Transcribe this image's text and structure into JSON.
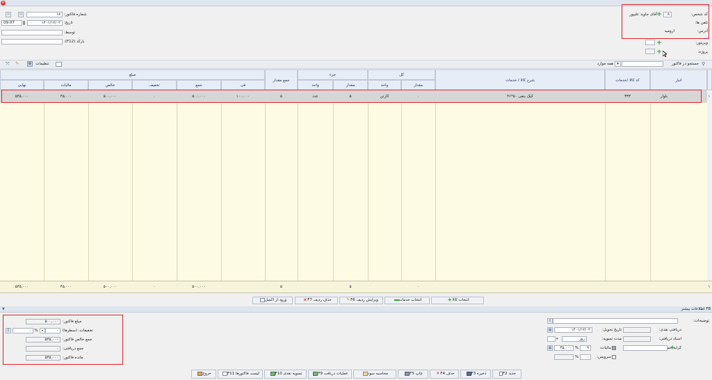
{
  "colors": {
    "accent": "#e0202a",
    "plus": "#2e9a3a",
    "grid_bg": "#fdfbe4",
    "row_selected": "#d6d6d6"
  },
  "header_right": {
    "person_code_label": "کد شخص:",
    "person_code_value": "۸",
    "person_name": "آقای جاوید علیپور",
    "phone_label": "تلفن ها:",
    "address_label": "آدرس:",
    "address_value": "ارومیه",
    "visitor_label": "ویزیتور:",
    "project_label": "پروژه:"
  },
  "header_left": {
    "invoice_no_label": "شماره فاکتور:",
    "invoice_no_value": "۱۸",
    "date_label": "تاریخ:",
    "date_value": "۱۴۰۱/۱۲/۰۲",
    "time_value": "09:07",
    "by_label": "توسط:",
    "barcode_label": "بارکد (F12):"
  },
  "search": {
    "label": "جستجو در فاکتور",
    "scope": "همه موارد",
    "settings_label": "تنظیمات"
  },
  "table": {
    "col_store": "انبار",
    "col_code": "کد کالا /خدمات",
    "col_desc": "شرح کالا / خدمات",
    "grp_total": "کل",
    "col_qty": "مقدار",
    "col_unit": "واحد",
    "grp_part": "جزء",
    "col_sum_qty": "جمع مقدار",
    "grp_amount": "مبلغ",
    "col_fee": "فی",
    "col_sum": "جمع",
    "col_discount": "تخفیف",
    "col_net": "خالص",
    "col_tax": "مالیات",
    "col_final": "نهایی",
    "rows": [
      {
        "index": "۱",
        "store": "بلوار",
        "code": "۳۳۳",
        "desc": "کیک بنفی ۵۰*۴۶",
        "total_qty": "۰",
        "total_unit": "کارتن",
        "part_qty": "۵",
        "part_unit": "عدد",
        "sum_qty": "۵",
        "fee": "۱۰۰,۰۰۰",
        "sum": "۵۰۰,۰۰۰",
        "discount": "۰",
        "net": "۵۰۰,۰۰۰",
        "tax": "۴۵,۰۰۰",
        "final": "۵۴۵,۰۰۰"
      }
    ],
    "totals": {
      "index": "۱",
      "total_qty": "۰",
      "part_qty": "۵",
      "sum_qty": "۵",
      "sum": "۵۰۰,۰۰۰",
      "discount": "۰",
      "net": "۵۰۰,۰۰۰",
      "tax": "۴۵,۰۰۰",
      "final": "۵۴۵,۰۰۰"
    }
  },
  "actions": {
    "select_goods": "انتخاب کالا",
    "select_services": "انتخاب خدمات",
    "edit_row": "ویرایش ردیف F6",
    "delete_row": "حذف ردیف F7",
    "import_excel": "ورود از اکسل"
  },
  "more_info": {
    "header": "F8 اطلاعات بیشتر",
    "notes_label": "توضیحات:",
    "delivery_date_label": "تاریخ تحویل:",
    "delivery_date_value": "۱۴۰۱/۱۲/۰۲",
    "cash_received_label": "دریافتی نقدی:",
    "settle_period_label": "مدت تسویه:",
    "settle_unit": "روز",
    "docs_received_label": "اسناد دریافتی:",
    "tax_label": "مالیات:",
    "tax_percent": "۹",
    "tax_amount": "۴۵,۰۰۰",
    "freight_label": "کرایه حمل:",
    "service_label": "سرویس:",
    "percent_sign": "%",
    "zero": "۰"
  },
  "summary": {
    "invoice_amount_label": "مبلغ فاکتور:",
    "invoice_amount": "۵۰۰,۰۰۰",
    "discounts_label": "تخفیفات: (سطرها)",
    "discounts_value": "۰",
    "net_total_label": "جمع خالص فاکتور:",
    "net_total": "۵۴۵,۰۰۰",
    "received_total_label": "جمع دریافتی:",
    "received_total": "۰",
    "remaining_label": "مانده فاکتور:",
    "remaining": "۵۴۵,۰۰۰",
    "percent_sign": "%"
  },
  "bottom": {
    "new": "جدید F2",
    "save": "ذخیره F3",
    "delete": "حذف F4",
    "print": "چاپ F5",
    "profit": "محاسبه سود",
    "receive_ops": "عملیات دریافت F9",
    "cash_settle": "تسویه نقدی F10",
    "invoice_list": "لیست فاکتورها F11",
    "exit": "خروج"
  }
}
